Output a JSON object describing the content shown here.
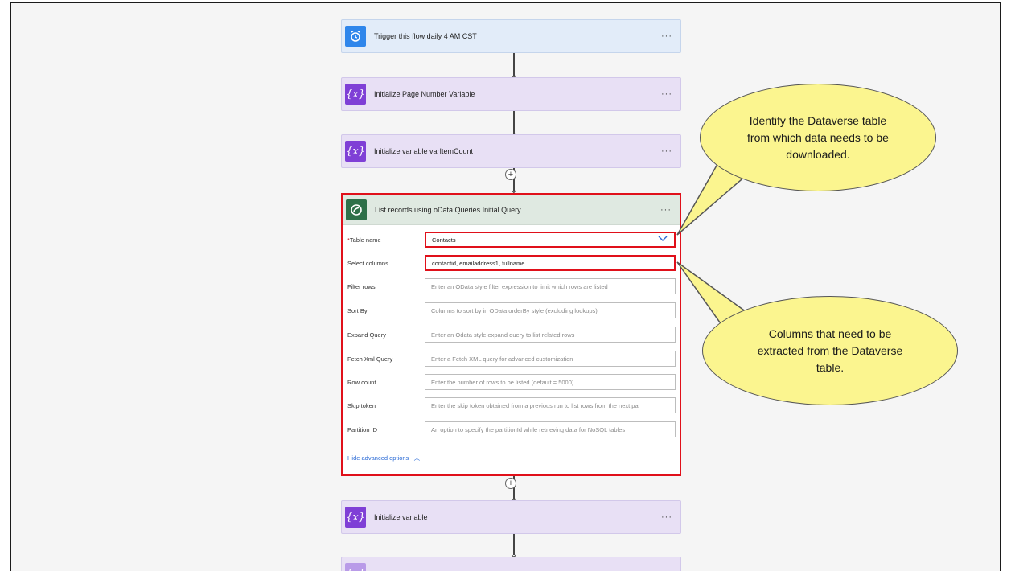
{
  "steps": {
    "trigger": {
      "title": "Trigger this flow daily 4 AM CST",
      "icon": "alarm-clock-icon"
    },
    "init_page": {
      "title": "Initialize Page Number Variable",
      "icon": "variable-icon"
    },
    "init_item_count": {
      "title": "Initialize variable varItemCount",
      "icon": "variable-icon"
    },
    "list_records": {
      "title": "List records using oData Queries Initial Query",
      "icon": "dataverse-icon"
    },
    "init_variable": {
      "title": "Initialize variable",
      "icon": "variable-icon"
    }
  },
  "more_label": "···",
  "plus_label": "+",
  "form": {
    "required_mark": "*",
    "table_name": {
      "label": "Table name",
      "value": "Contacts"
    },
    "select_columns": {
      "label": "Select columns",
      "value": "contactid, emailaddress1, fullname"
    },
    "filter_rows": {
      "label": "Filter rows",
      "placeholder": "Enter an OData style filter expression to limit which rows are listed"
    },
    "sort_by": {
      "label": "Sort By",
      "placeholder": "Columns to sort by in OData orderBy style (excluding lookups)"
    },
    "expand_query": {
      "label": "Expand Query",
      "placeholder": "Enter an Odata style expand query to list related rows"
    },
    "fetch_xml": {
      "label": "Fetch Xml Query",
      "placeholder": "Enter a Fetch XML query for advanced customization"
    },
    "row_count": {
      "label": "Row count",
      "placeholder": "Enter the number of rows to be listed (default = 5000)"
    },
    "skip_token": {
      "label": "Skip token",
      "placeholder": "Enter the skip token obtained from a previous run to list rows from the next pa"
    },
    "partition_id": {
      "label": "Partition ID",
      "placeholder": "An option to specify the partitionId while retrieving data for NoSQL tables"
    },
    "hide_advanced": "Hide advanced options"
  },
  "callouts": {
    "table": "Identify the Dataverse table from which data needs to be downloaded.",
    "columns": "Columns that need to be extracted from the Dataverse table."
  },
  "colors": {
    "highlight": "#e0101a",
    "callout": "#fbf58f",
    "variable": "#7f3fd6",
    "trigger": "#2f86eb",
    "dataverse": "#2e7049"
  }
}
